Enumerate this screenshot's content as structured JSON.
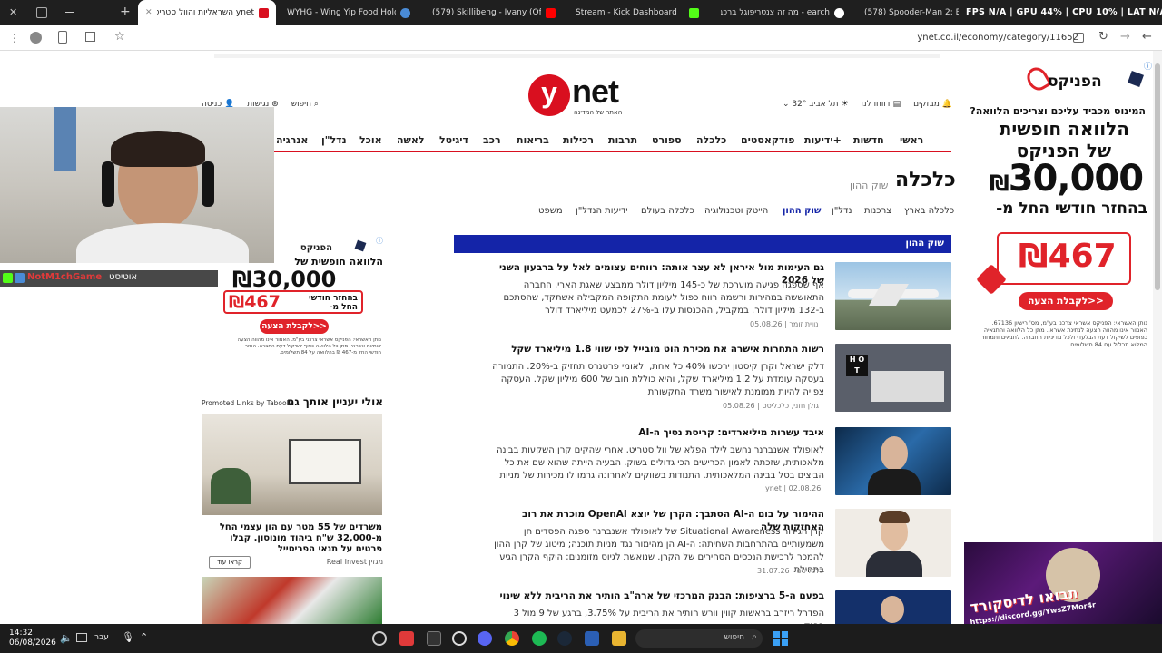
{
  "tabs": [
    {
      "label": "ynet השראליות והוול סטריט"
    },
    {
      "label": "WYHG - Wing Yip Food Holdin"
    },
    {
      "label": "(579) Skillibeng - Ivany (Official"
    },
    {
      "label": "Stream - Kick Dashboard"
    },
    {
      "label": "earch - מה זה צנטריפוגל ברכב"
    },
    {
      "label": "(578) Spooder-Man 2: Brand"
    }
  ],
  "overlay_stats": "FPS N/A | GPU 44% | CPU 10% | LAT N/A",
  "url": "ynet.co.il/economy/category/11652",
  "site": {
    "logo": "ynet",
    "logo_tagline": "האתר של המדינה",
    "top_links": {
      "login": "כניסה",
      "accessibility": "נגישות",
      "search": "חיפוש",
      "weather": "32° תל אביב",
      "report": "דווחו לנו",
      "alerts": "מבזקים"
    },
    "nav": [
      "ראשי",
      "חדשות",
      "ידיעות+",
      "פודקאסטים",
      "כלכלה",
      "ספורט",
      "תרבות",
      "רכילות",
      "בריאות",
      "רכב",
      "דיגיטל",
      "לאשה",
      "אוכל",
      "נדל\"ן",
      "אנרגיה"
    ],
    "section_title": "כלכלה",
    "section_sub": "שוק ההון",
    "subcats": [
      "כלכלה בארץ",
      "צרכנות",
      "נדל\"ן",
      "שוק ההון",
      "הייטק וטכנולוגיה",
      "כלכלה בעולם",
      "ידיעות הנדל\"ן",
      "משפט"
    ],
    "bar_title": "שוק ההון"
  },
  "articles": [
    {
      "title": "גם העימות מול איראן לא עצר אותה: רווחים עצומים לאל על ברבעון השני של 2026",
      "body": "אף שספגה פגיעה מוערכת של כ-145 מיליון דולר ממבצע שאגת הארי, החברה התאוששה במהירות ורשמה רווח כפול לעומת התקופה המקבילה אשתקד, שהסתכם ב-132 מיליון דולר. במקביל, ההכנסות עלו ב-27% לכמעט מיליארד דולר",
      "author": "נווית זומר",
      "date": "05.08.26"
    },
    {
      "title": "רשות התחרות אישרה את מכירת הוט מובייל לפי שווי 1.8 מיליארד שקל",
      "body": "דלק ישראל וקרן קיסטון ירכשו 40% כל אחת, ולאומי פרטנרס תחזיק ב-20%. התמורה בעסקה עומדת על 1.2 מיליארד שקל, והיא כוללת חוב של 600 מיליון שקל. העסקה צפויה להיות ממומנת לאישור משרד התקשורת",
      "author": "גולן חזני, כלכליסט",
      "date": "05.08.26"
    },
    {
      "title": "איבד עשרות מיליארדים: קריסת נסיך ה-AI",
      "body": "לאופולד אשנברנר נחשב לילד הפלא של וול סטריט, אחרי שהקים קרן השקעות בבינה מלאכותית, שזכתה לאמון הכרישים הכי גדולים בשוק. הבעיה הייתה שהוא שם את כל הביצים בסל בבינה המלאכותית. התנודות בשווקים לאחרונה גרמו לו מכירות של מניות",
      "author": "ynet",
      "date": "02.08.26"
    },
    {
      "title": "ההימור על בום ה-AI הסתבך: הקרן של יוצא OpenAI מוכרת את רוב האחזקות שלה",
      "body": "קרן הגידור Situational Awareness של לאופולד אשנברנר ספגה הפסדים חן משמעותיים בהתרחבות השחיתה: ה-AI הן מהימור נגד מניות תוכנה; מיטוג של קרן ההון להמכר לרכישת הנכסים הסחירים של הקרן. שנואשת לגיוס מזומנים; היקף הקרן הגיע בתחילת",
      "author": "כלכליסט",
      "date": "31.07.26"
    },
    {
      "title": "בפעם ה-5 ברציפות: הבנק המרכזי של ארה\"ב הותיר את הריבית ללא שינוי",
      "body": "הפדרל ריזרב בראשות קווין וורש הותיר את הריבית על 3.75%, ברגע של 9 מול 3 בבנק",
      "author": "",
      "date": ""
    }
  ],
  "ads": {
    "brand": "הפניקס",
    "question": "המינוס מכביד עליכם וצריכים הלוואה?",
    "headline1": "הלוואה חופשית",
    "headline2": "של הפניקס",
    "amount": "30,000",
    "currency": "₪",
    "after_label": "בהחזר חודשי החל מ-",
    "monthly": "467",
    "cta": "לקבלת הצעה>>",
    "fine_print": "נותן האשראי: הפניקס אשראי צרכני בע\"מ, מס' רישיון 67136. האמור אינו מהווה הצעה לנתינת אשראי. מתן כל הלוואה והתנאיה כפופים לשיקול דעת הבלעדי ולכל מדיניות החברה. לתנאים ותמחור המלוא תכלול עם 84 תשלומים",
    "side_headline": "הלוואה חופשית של",
    "side_amount": "30,000",
    "side_after": "בהחזר חודשי החל מ-",
    "side_monthly": "467",
    "side_cta": "לקבלת הצעה>>",
    "side_fine": "נותן האשראי: הפניקס אשראי צרכני בע\"מ. האמור אינו מהווה הצעה לנתינת אשראי. מתן כל הלוואה כפוף לשיקול דעת החברה. החזר חודשי החל מ-467 ₪ בהלוואה על 84 תשלומים."
  },
  "taboola": {
    "header": "אולי יעניין אותך גם",
    "promoted": "Promoted Links by Taboola",
    "item1_title": "משרדים של 55 מטר עם הון עצמי החל מ-32,000 ש\"ח ביהוד מונוסון. קבלו פרטים על תנאי הפריסייל",
    "item1_source": "מגזין Real Invest",
    "item1_cta": "קראו עוד"
  },
  "stream": {
    "chat_name": "NotM1chGame",
    "chat_text": "אוטיסט",
    "promo_text": "תבואו לדיסקורד",
    "promo_url": "https://discord.gg/YwsZ7Mor4r"
  },
  "taskbar": {
    "time": "14:32",
    "date": "06/08/2026",
    "lang": "עבר",
    "search_placeholder": "חיפוש"
  },
  "colors": {
    "accent": "#d90f1f",
    "bar": "#1424a8",
    "ad_red": "#e0232a"
  }
}
